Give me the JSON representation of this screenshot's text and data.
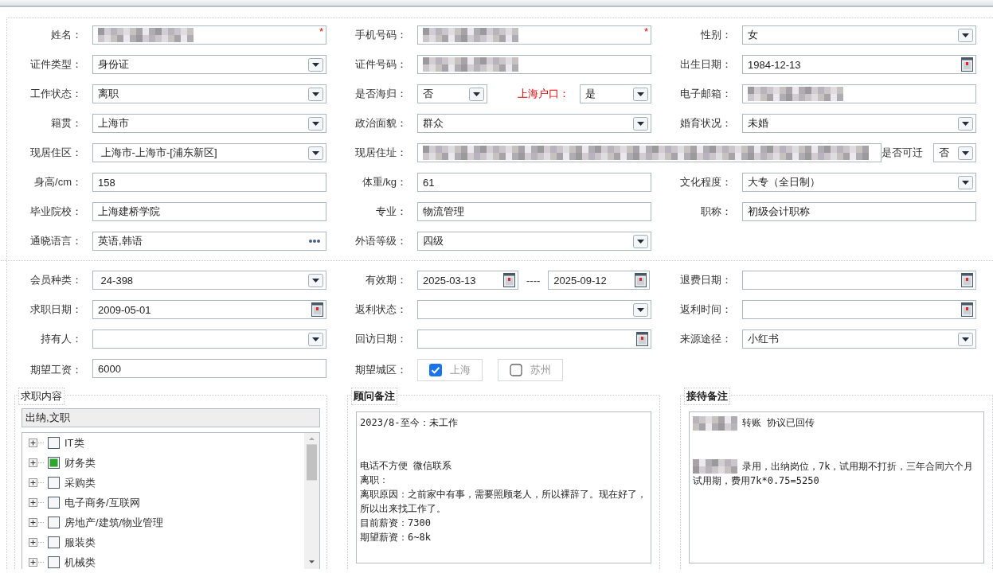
{
  "basic_rows": [
    [
      {
        "label": "姓名：",
        "control": {
          "kind": "redacted",
          "required_mark": "*"
        }
      },
      {
        "label": "手机号码：",
        "control": {
          "kind": "redacted",
          "required_mark": "*"
        }
      },
      {
        "label": "性别：",
        "control": {
          "kind": "select",
          "value": "女"
        }
      }
    ],
    [
      {
        "label": "证件类型：",
        "control": {
          "kind": "select",
          "value": "身份证"
        }
      },
      {
        "label": "证件号码：",
        "control": {
          "kind": "redacted"
        }
      },
      {
        "label": "出生日期：",
        "control": {
          "kind": "date",
          "value": "1984-12-13"
        }
      }
    ],
    [
      {
        "label": "工作状态：",
        "control": {
          "kind": "select",
          "value": "离职"
        }
      },
      {
        "label": "是否海归：",
        "control": {
          "kind": "select",
          "value": "否"
        },
        "extra": {
          "label": "上海户口：",
          "highlight": true,
          "control": {
            "kind": "select",
            "value": "是"
          }
        }
      },
      {
        "label": "电子邮箱：",
        "control": {
          "kind": "redacted"
        }
      }
    ],
    [
      {
        "label": "籍贯：",
        "control": {
          "kind": "select",
          "value": "上海市"
        }
      },
      {
        "label": "政治面貌：",
        "control": {
          "kind": "select",
          "value": "群众"
        }
      },
      {
        "label": "婚育状况：",
        "control": {
          "kind": "select",
          "value": "未婚"
        }
      }
    ],
    [
      {
        "label": "现居住区：",
        "control": {
          "kind": "select",
          "value": " 上海市-上海市-[浦东新区]"
        }
      },
      {
        "label": "现居住址：",
        "control": {
          "kind": "redacted"
        },
        "extra": {
          "label": "是否可迁",
          "highlight": false,
          "control": {
            "kind": "select",
            "value": "否"
          }
        }
      }
    ],
    [
      {
        "label": "身高/cm：",
        "control": {
          "kind": "text",
          "value": "158"
        }
      },
      {
        "label": "体重/kg：",
        "control": {
          "kind": "text",
          "value": "61"
        }
      },
      {
        "label": "文化程度：",
        "control": {
          "kind": "select",
          "value": "大专（全日制）"
        }
      }
    ],
    [
      {
        "label": "毕业院校：",
        "control": {
          "kind": "text",
          "value": "上海建桥学院"
        }
      },
      {
        "label": "专业：",
        "control": {
          "kind": "text",
          "value": "物流管理"
        }
      },
      {
        "label": "职称：",
        "control": {
          "kind": "text",
          "value": "初级会计职称"
        }
      }
    ],
    [
      {
        "label": "通晓语言：",
        "control": {
          "kind": "picker",
          "value": "英语,韩语"
        }
      },
      {
        "label": "外语等级：",
        "control": {
          "kind": "select",
          "value": "四级"
        }
      }
    ]
  ],
  "member_rows": [
    [
      {
        "label": "会员种类：",
        "control": {
          "kind": "select",
          "value": " 24-398"
        }
      },
      {
        "label": "有效期：",
        "control": {
          "kind": "date_range",
          "from": "2025-03-13",
          "separator": "----",
          "to": "2025-09-12"
        }
      },
      {
        "label": "退费日期：",
        "control": {
          "kind": "date"
        }
      }
    ],
    [
      {
        "label": "求职日期：",
        "control": {
          "kind": "date",
          "value": "2009-05-01"
        }
      },
      {
        "label": "返利状态：",
        "control": {
          "kind": "select"
        }
      },
      {
        "label": "返利时间：",
        "control": {
          "kind": "date"
        }
      }
    ],
    [
      {
        "label": "持有人：",
        "control": {
          "kind": "select"
        }
      },
      {
        "label": "回访日期：",
        "control": {
          "kind": "date"
        }
      },
      {
        "label": "来源途径：",
        "control": {
          "kind": "select",
          "value": "小红书"
        }
      }
    ],
    [
      {
        "label": "期望工资：",
        "control": {
          "kind": "text",
          "value": "6000"
        }
      },
      {
        "label": "期望城区：",
        "control": {
          "kind": "checkbox_group",
          "options": [
            {
              "label": "上海",
              "checked": true
            },
            {
              "label": "苏州",
              "checked": false
            }
          ]
        }
      }
    ]
  ],
  "job_content": {
    "title": "求职内容",
    "summary": "出纳,文职",
    "tree": [
      {
        "label": "IT类",
        "expanded": false,
        "partial": false
      },
      {
        "label": "财务类",
        "expanded": false,
        "partial": true
      },
      {
        "label": "采购类",
        "expanded": false,
        "partial": false
      },
      {
        "label": "电子商务/互联网",
        "expanded": false,
        "partial": false
      },
      {
        "label": "房地产/建筑/物业管理",
        "expanded": false,
        "partial": false
      },
      {
        "label": "服装类",
        "expanded": false,
        "partial": false
      },
      {
        "label": "机械类",
        "expanded": false,
        "partial": false
      }
    ]
  },
  "consultant_notes": {
    "title": "顾问备注",
    "paragraphs": [
      {
        "lines": [
          {
            "text": "2023/8-至今：未工作",
            "redacted": false
          }
        ]
      },
      {
        "lines": [
          {
            "text": "电话不方便 微信联系",
            "redacted": false
          },
          {
            "text": "离职：",
            "redacted": false
          },
          {
            "text": "离职原因：之前家中有事，需要照顾老人，所以裸辞了。现在好了，所以出来找工作了。",
            "redacted": false
          },
          {
            "text": "目前薪资：7300",
            "redacted": false
          },
          {
            "text": "期望薪资：6~8k",
            "redacted": false
          }
        ]
      }
    ]
  },
  "reception_notes": {
    "title": "接待备注",
    "paragraphs": [
      {
        "lines": [
          {
            "text": "转账 协议已回传",
            "redacted": true
          }
        ]
      },
      {
        "lines": [
          {
            "text": "录用，出纳岗位，7k，试用期不打折，三年合同六个月试用期，费用7k*0.75=5250",
            "redacted": true
          }
        ]
      }
    ]
  }
}
